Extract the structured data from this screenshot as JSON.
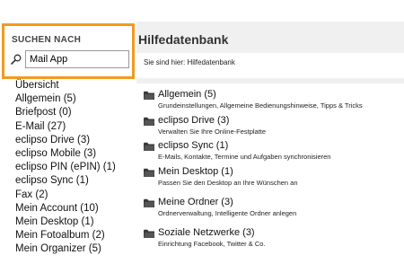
{
  "search": {
    "title": "SUCHEN NACH",
    "value": "Mail App",
    "accent_color": "#f39a1e"
  },
  "sidebar": {
    "items": [
      {
        "label": "Übersicht"
      },
      {
        "label": "Allgemein (5)"
      },
      {
        "label": "Briefpost (0)"
      },
      {
        "label": "E-Mail (27)"
      },
      {
        "label": "eclipso Drive (3)"
      },
      {
        "label": "eclipso Mobile (3)"
      },
      {
        "label": "eclipso PIN (ePIN) (1)"
      },
      {
        "label": "eclipso Sync (1)"
      },
      {
        "label": "Fax (2)"
      },
      {
        "label": "Mein Account (10)"
      },
      {
        "label": "Mein Desktop (1)"
      },
      {
        "label": "Mein Fotoalbum (2)"
      },
      {
        "label": "Mein Organizer (5)"
      }
    ]
  },
  "main": {
    "title": "Hilfedatenbank",
    "breadcrumb": "Sie sind hier: Hilfedatenbank",
    "categories": [
      {
        "title": "Allgemein (5)",
        "desc": "Grundeinstellungen, Allgemeine Bedienungshinweise, Tipps & Tricks",
        "icon": "folder-icon"
      },
      {
        "title": "eclipso Drive (3)",
        "desc": "Verwalten Sie Ihre Online-Festplatte",
        "icon": "folder-icon"
      },
      {
        "title": "eclipso Sync (1)",
        "desc": "E-Mails, Kontakte, Termine und Aufgaben synchronisieren",
        "icon": "folder-icon"
      },
      {
        "title": "Mein Desktop (1)",
        "desc": "Passen Sie den Desktop an Ihre Wünschen an",
        "icon": "folder-icon"
      },
      {
        "title": "Meine Ordner (3)",
        "desc": "Ordnerverwaltung, Intelligente Ordner anlegen",
        "icon": "folder-icon"
      },
      {
        "title": "Soziale Netzwerke (3)",
        "desc": "Einrichtung Facebook, Twitter & Co.",
        "icon": "folder-icon"
      }
    ]
  }
}
